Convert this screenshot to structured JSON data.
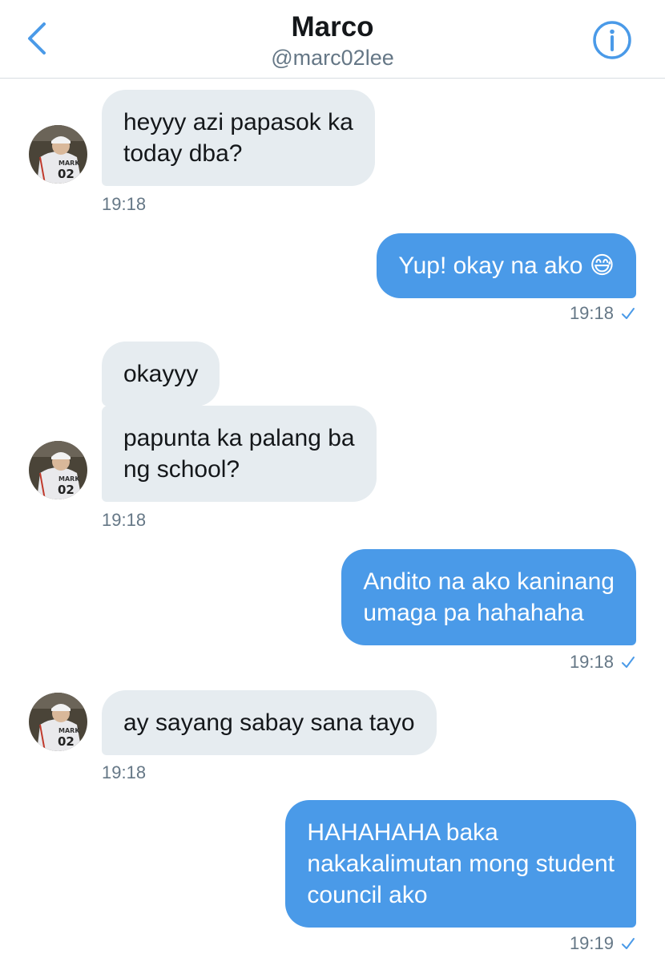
{
  "header": {
    "name": "Marco",
    "handle": "@marc02lee",
    "back_icon": "chevron-left-icon",
    "info_icon": "info-icon",
    "accent_color": "#4a9ae8"
  },
  "avatar": {
    "jersey_name": "MARK",
    "jersey_number": "02"
  },
  "messages": [
    {
      "direction": "incoming",
      "lines": [
        "heyyy azi papasok ka",
        "today dba?"
      ],
      "time": "19:18"
    },
    {
      "direction": "outgoing",
      "lines": [
        "Yup! okay na ako 😅"
      ],
      "time": "19:18",
      "status": "sent-check-icon"
    },
    {
      "direction": "incoming",
      "lines": [
        "okayyy"
      ]
    },
    {
      "direction": "incoming",
      "lines": [
        "papunta ka palang ba",
        "ng school?"
      ],
      "time": "19:18"
    },
    {
      "direction": "outgoing",
      "lines": [
        "Andito na ako kaninang",
        "umaga pa hahahaha"
      ],
      "time": "19:18",
      "status": "sent-check-icon"
    },
    {
      "direction": "incoming",
      "lines": [
        "ay sayang sabay sana tayo"
      ],
      "time": "19:18"
    },
    {
      "direction": "outgoing",
      "lines": [
        "HAHAHAHA baka",
        "nakakalimutan mong student",
        "council ako"
      ],
      "time": "19:19",
      "status": "sent-check-icon"
    }
  ]
}
